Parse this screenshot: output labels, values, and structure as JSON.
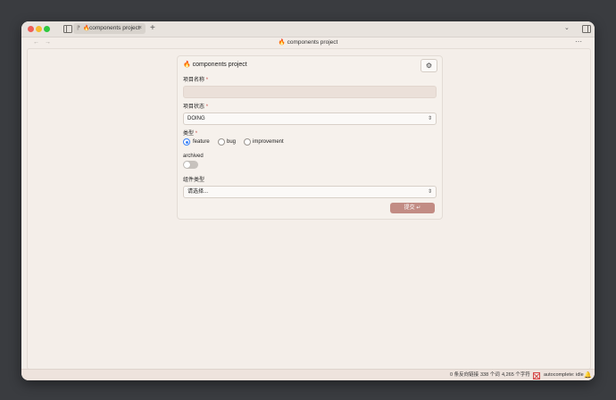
{
  "tab": {
    "pin_icon": "⁋",
    "fire": "🔥",
    "title": "components project",
    "close": "×"
  },
  "new_tab": "+",
  "tab_list": "⌄",
  "nav": {
    "back": "←",
    "forward": "→",
    "title": "🔥 components project",
    "more": "⋯"
  },
  "form": {
    "title": "🔥 components project",
    "settings_icon": "⚙",
    "name_label": "项目名称",
    "name_value": "",
    "required_mark": "*",
    "status_label": "项目状态",
    "status_value": "DOING",
    "type_label": "类型",
    "type_options": [
      {
        "label": "feature",
        "checked": true
      },
      {
        "label": "bug",
        "checked": false
      },
      {
        "label": "improvement",
        "checked": false
      }
    ],
    "archived_label": "archived",
    "archived_value": false,
    "component_type_label": "组件类型",
    "component_type_placeholder": "请选择...",
    "select_arrow": "⇕",
    "submit_label": "提交 ↵"
  },
  "statusbar": {
    "backlinks": "0 条反向链接",
    "word_count": "338 个词",
    "char_count": "4,265 个字符",
    "autocomplete": "autocomplete: idle",
    "bell": "🔔"
  },
  "colors": {
    "accent": "#c28c84",
    "radio_blue": "#3b82f6",
    "required": "#c8504a",
    "background": "#f3ede8"
  }
}
